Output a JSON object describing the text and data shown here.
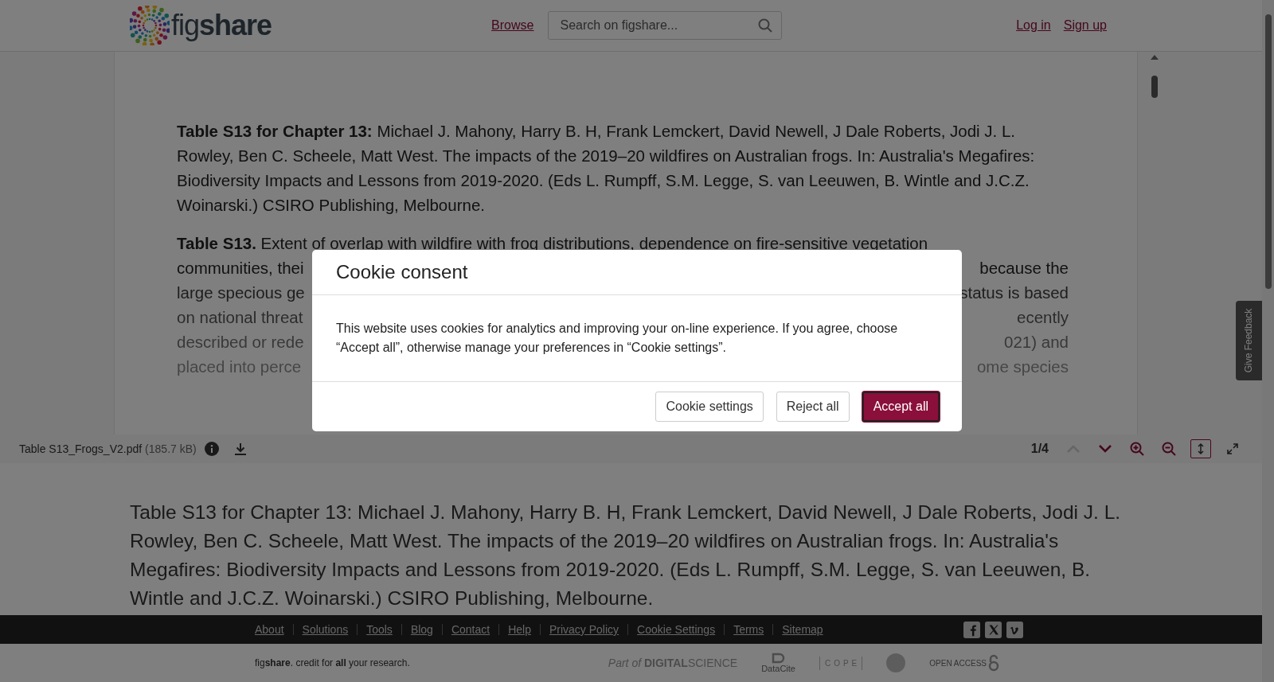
{
  "header": {
    "logo": "fig**share**",
    "nav_link": "Browse",
    "search": {
      "placeholder": "Search on figshare..."
    },
    "auth_links": [
      "Log in",
      "Sign up"
    ]
  },
  "viewer": {
    "paragraphs": [
      "**Table S13 for Chapter 13:** Michael J. Mahony, Harry B. H, Frank Lemckert, David Newell, J Dale Roberts, Jodi J. L. Rowley, Ben C. Scheele, Matt West. The impacts of the 2019–20 wildfires on Australian frogs. In: Australia's Megafires: Biodiversity Impacts and Lessons from 2019-2020.  (Eds L. Rumpff, S.M. Legge, S. van Leeuwen, B. Wintle and J.C.Z. Woinarski.) CSIRO Publishing, Melbourne.",
      "**Table S13.** Extent of overlap with wildfire with frog distributions, dependence on fire-sensitive vegetation"
    ],
    "partial_lines": [
      {
        "left": "communities, thei",
        "right": "because the"
      },
      {
        "left": "large specious ge",
        "right": "status is based"
      },
      {
        "left": "on national threat",
        "right": "ecently"
      },
      {
        "left": "described or rede",
        "right": "021) and"
      },
      {
        "left": "placed into perce",
        "right": "ome species"
      }
    ],
    "toolbar": {
      "file_name": "Table S13_Frogs_V2.pdf",
      "file_size": "(185.7 kB)",
      "page": "1/4",
      "previous_disabled": true,
      "fit_height_selected": true
    }
  },
  "description": "Table S13 for Chapter 13: Michael J. Mahony, Harry B. H, Frank Lemckert, David Newell, J Dale Roberts, Jodi J. L. Rowley, Ben C. Scheele, Matt West. The impacts of the 2019–20 wildfires on Australian frogs. In: Australia's Megafires: Biodiversity Impacts and Lessons from 2019-2020. (Eds L. Rumpff, S.M. Legge, S. van Leeuwen, B. Wintle and J.C.Z. Woinarski.) CSIRO Publishing, Melbourne.",
  "footer": {
    "links": [
      "About",
      "Solutions",
      "Tools",
      "Blog",
      "Contact",
      "Help",
      "Privacy Policy",
      "Cookie Settings",
      "Terms",
      "Sitemap"
    ],
    "social": [
      {
        "kind": "facebook"
      },
      {
        "kind": "x"
      },
      {
        "kind": "vimeo"
      }
    ],
    "tagline": "fig**share**. credit for **all** your research.",
    "partners": [
      {
        "kind": "digital_science",
        "label": "*Part of* **DIGITAL**SCIENCE"
      },
      {
        "kind": "datacite",
        "label": "DataCite"
      },
      {
        "kind": "cope",
        "label": "COPE"
      },
      {
        "kind": "seal"
      },
      {
        "kind": "open_access",
        "label": "OPEN ACCESS"
      }
    ]
  },
  "feedback_tab": "Give Feedback",
  "cookie_dialog": {
    "title": "Cookie consent",
    "body": "This website uses cookies for analytics and improving your on-line experience. If you agree, choose “Accept all”, otherwise manage your preferences in “Cookie settings”.",
    "buttons": [
      {
        "label": "Cookie settings",
        "primary": false
      },
      {
        "label": "Reject all",
        "primary": false
      },
      {
        "label": "Accept all",
        "primary": true
      }
    ]
  }
}
